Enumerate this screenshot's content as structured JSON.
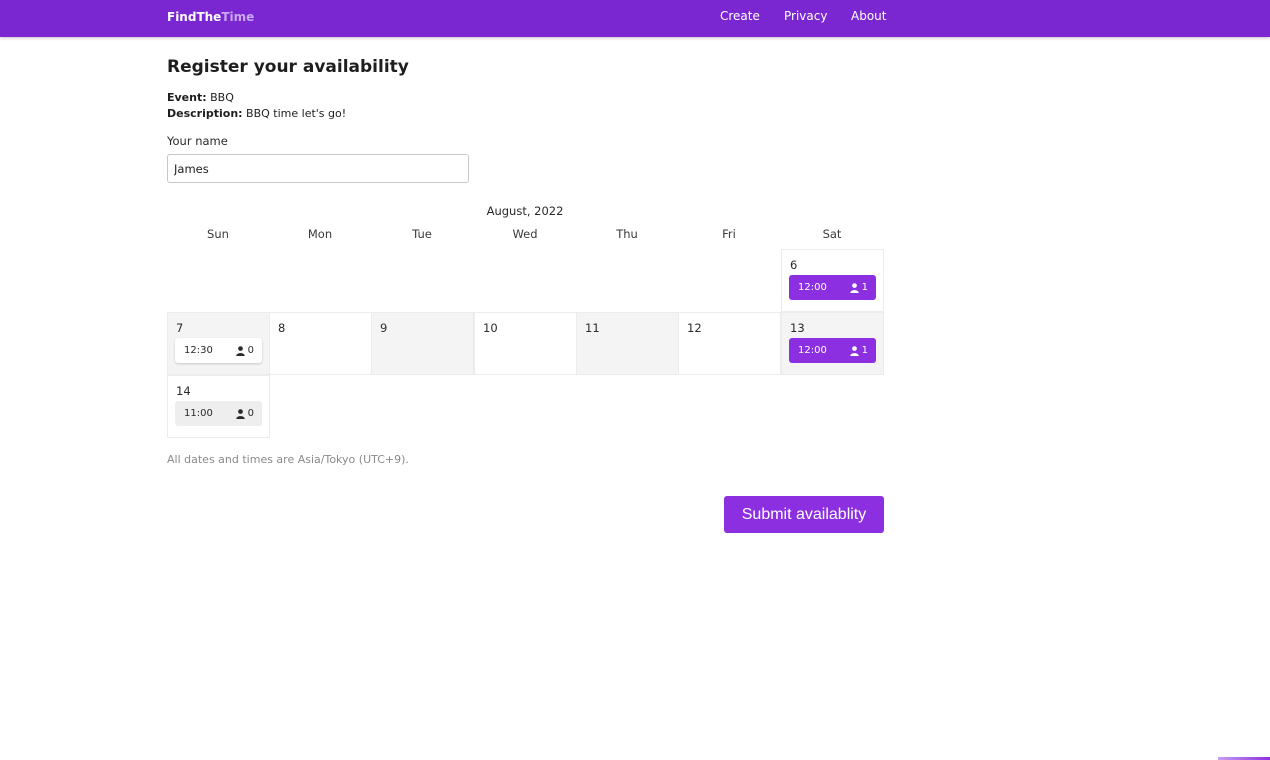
{
  "navbar": {
    "brand_primary": "FindThe",
    "brand_secondary": "Time",
    "links": [
      "Create",
      "Privacy",
      "About"
    ]
  },
  "page": {
    "title": "Register your availability",
    "event_label": "Event:",
    "event_value": "BBQ",
    "description_label": "Description:",
    "description_value": "BBQ time let's go!"
  },
  "form": {
    "name_label": "Your name",
    "name_value": "James"
  },
  "calendar": {
    "month": "August, 2022",
    "weekdays": [
      "Sun",
      "Mon",
      "Tue",
      "Wed",
      "Thu",
      "Fri",
      "Sat"
    ],
    "days": [
      {
        "day": "6",
        "slot": {
          "time": "12:00",
          "count": "1",
          "state": "selected"
        }
      },
      {
        "day": "7",
        "slot": {
          "time": "12:30",
          "count": "0",
          "state": "unselected"
        }
      },
      {
        "day": "8"
      },
      {
        "day": "9"
      },
      {
        "day": "10"
      },
      {
        "day": "11"
      },
      {
        "day": "12"
      },
      {
        "day": "13",
        "slot": {
          "time": "12:00",
          "count": "1",
          "state": "selected"
        }
      },
      {
        "day": "14",
        "slot": {
          "time": "11:00",
          "count": "0",
          "state": "unselected"
        }
      }
    ]
  },
  "timezone_note": "All dates and times are Asia/Tokyo (UTC+9).",
  "submit_label": "Submit availablity",
  "colors": {
    "brand": "#7a27d1",
    "accent": "#8b2fe0",
    "brand_secondary_text": "#c9a8f2"
  }
}
